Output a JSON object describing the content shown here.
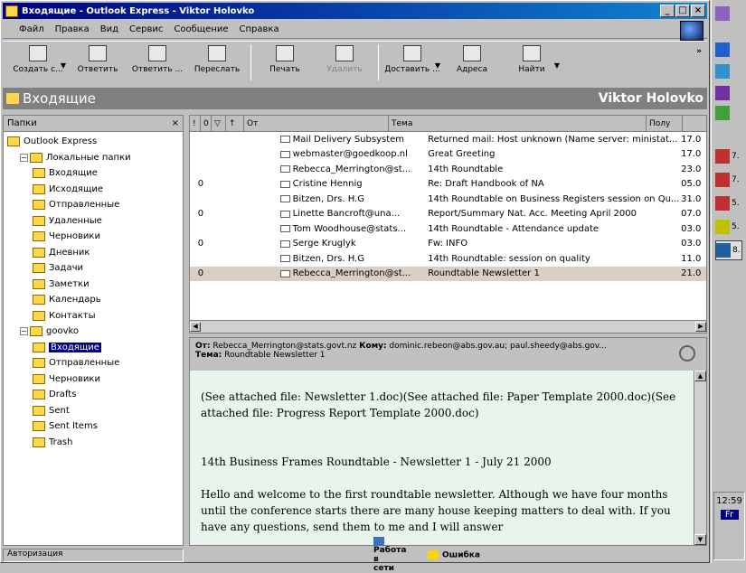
{
  "window": {
    "title": "Входящие - Outlook Express - Viktor Holovko",
    "btn_min": "_",
    "btn_max": "□",
    "btn_close": "×"
  },
  "menu": [
    "Файл",
    "Правка",
    "Вид",
    "Сервис",
    "Сообщение",
    "Справка"
  ],
  "toolbar": [
    {
      "label": "Создать с...",
      "icon": "create-mail-icon",
      "dd": true
    },
    {
      "label": "Ответить",
      "icon": "reply-icon"
    },
    {
      "label": "Ответить ...",
      "icon": "reply-all-icon"
    },
    {
      "label": "Переслать",
      "icon": "forward-icon"
    },
    {
      "label": "Печать",
      "icon": "print-icon"
    },
    {
      "label": "Удалить",
      "icon": "delete-icon",
      "disabled": true
    },
    {
      "label": "Доставить ...",
      "icon": "send-receive-icon",
      "dd": true
    },
    {
      "label": "Адреса",
      "icon": "addresses-icon"
    },
    {
      "label": "Найти",
      "icon": "find-icon",
      "dd": true
    }
  ],
  "folder_bar": {
    "title": "Входящие",
    "user": "Viktor Holovko"
  },
  "left_pane": {
    "header": "Папки",
    "close": "×",
    "tree": [
      {
        "label": "Outlook Express",
        "indent": 0,
        "exp": ""
      },
      {
        "label": "Локальные папки",
        "indent": 1,
        "exp": "−"
      },
      {
        "label": "Входящие",
        "indent": 2
      },
      {
        "label": "Исходящие",
        "indent": 2
      },
      {
        "label": "Отправленные",
        "indent": 2
      },
      {
        "label": "Удаленные",
        "indent": 2
      },
      {
        "label": "Черновики",
        "indent": 2
      },
      {
        "label": "Дневник",
        "indent": 2
      },
      {
        "label": "Задачи",
        "indent": 2
      },
      {
        "label": "Заметки",
        "indent": 2
      },
      {
        "label": "Календарь",
        "indent": 2
      },
      {
        "label": "Контакты",
        "indent": 2
      },
      {
        "label": "goovko",
        "indent": 1,
        "exp": "−"
      },
      {
        "label": "Входящие",
        "indent": 2,
        "selected": true
      },
      {
        "label": "Отправленные",
        "indent": 2
      },
      {
        "label": "Черновики",
        "indent": 2
      },
      {
        "label": "Drafts",
        "indent": 2
      },
      {
        "label": "Sent",
        "indent": 2
      },
      {
        "label": "Sent Items",
        "indent": 2
      },
      {
        "label": "Trash",
        "indent": 2
      }
    ]
  },
  "message_list": {
    "headers": [
      "!",
      "0",
      "▽",
      "↑",
      "От",
      "Тема",
      "Полу"
    ],
    "rows": [
      {
        "att": "",
        "from": "Mail Delivery Subsystem",
        "subject": "Returned mail: Host unknown (Name server: ministat...",
        "date": "17.0"
      },
      {
        "att": "",
        "from": "webmaster@goedkoop.nl",
        "subject": "Great Greeting",
        "date": "17.0"
      },
      {
        "att": "",
        "from": "Rebecca_Merrington@st...",
        "subject": "14th Roundtable",
        "date": "23.0"
      },
      {
        "att": "0",
        "from": "Cristine Hennig",
        "subject": "Re: Draft Handbook of NA",
        "date": "05.0"
      },
      {
        "att": "",
        "from": "Bitzen, Drs. H.G",
        "subject": "14th Roundtable on Business Registers session on Qu...",
        "date": "31.0"
      },
      {
        "att": "0",
        "from": "Linette Bancroft@una...",
        "subject": "Report/Summary Nat. Acc. Meeting April 2000",
        "date": "07.0"
      },
      {
        "att": "",
        "from": "Tom Woodhouse@stats...",
        "subject": "14th Roundtable - Attendance update",
        "date": "03.0"
      },
      {
        "att": "0",
        "from": "Serge Kruglyk",
        "subject": "Fw: INFO",
        "date": "03.0"
      },
      {
        "att": "",
        "from": "Bitzen, Drs. H.G",
        "subject": "14th Roundtable: session on quality",
        "date": "11.0"
      },
      {
        "att": "0",
        "from": "Rebecca_Merrington@st...",
        "subject": "Roundtable Newsletter 1",
        "date": "21.0",
        "selected": true
      }
    ]
  },
  "preview": {
    "from_label": "От:",
    "from": "Rebecca_Merrington@stats.govt.nz",
    "to_label": "Кому:",
    "to": "dominic.rebeon@abs.gov.au; paul.sheedy@abs.gov...",
    "subject_label": "Тема:",
    "subject": "Roundtable Newsletter 1",
    "p1": "(See attached file: Newsletter 1.doc)(See attached file: Paper Template 2000.doc)(See attached file: Progress Report Template 2000.doc)",
    "p2": "14th Business Frames Roundtable - Newsletter 1 - July 21 2000",
    "p3": "Hello and welcome to the first roundtable newsletter. Although we have four months until the conference starts there are many house keeping matters to deal with. If you have any questions, send them to me and I will answer"
  },
  "status": {
    "left": "Авторизация",
    "middle": "Работа в сети",
    "right": "Ошибка"
  },
  "taskbar": {
    "items": [
      "7.",
      "7.",
      "5.",
      "5.",
      "8."
    ],
    "clock": "12:59",
    "lang": "Fr"
  }
}
